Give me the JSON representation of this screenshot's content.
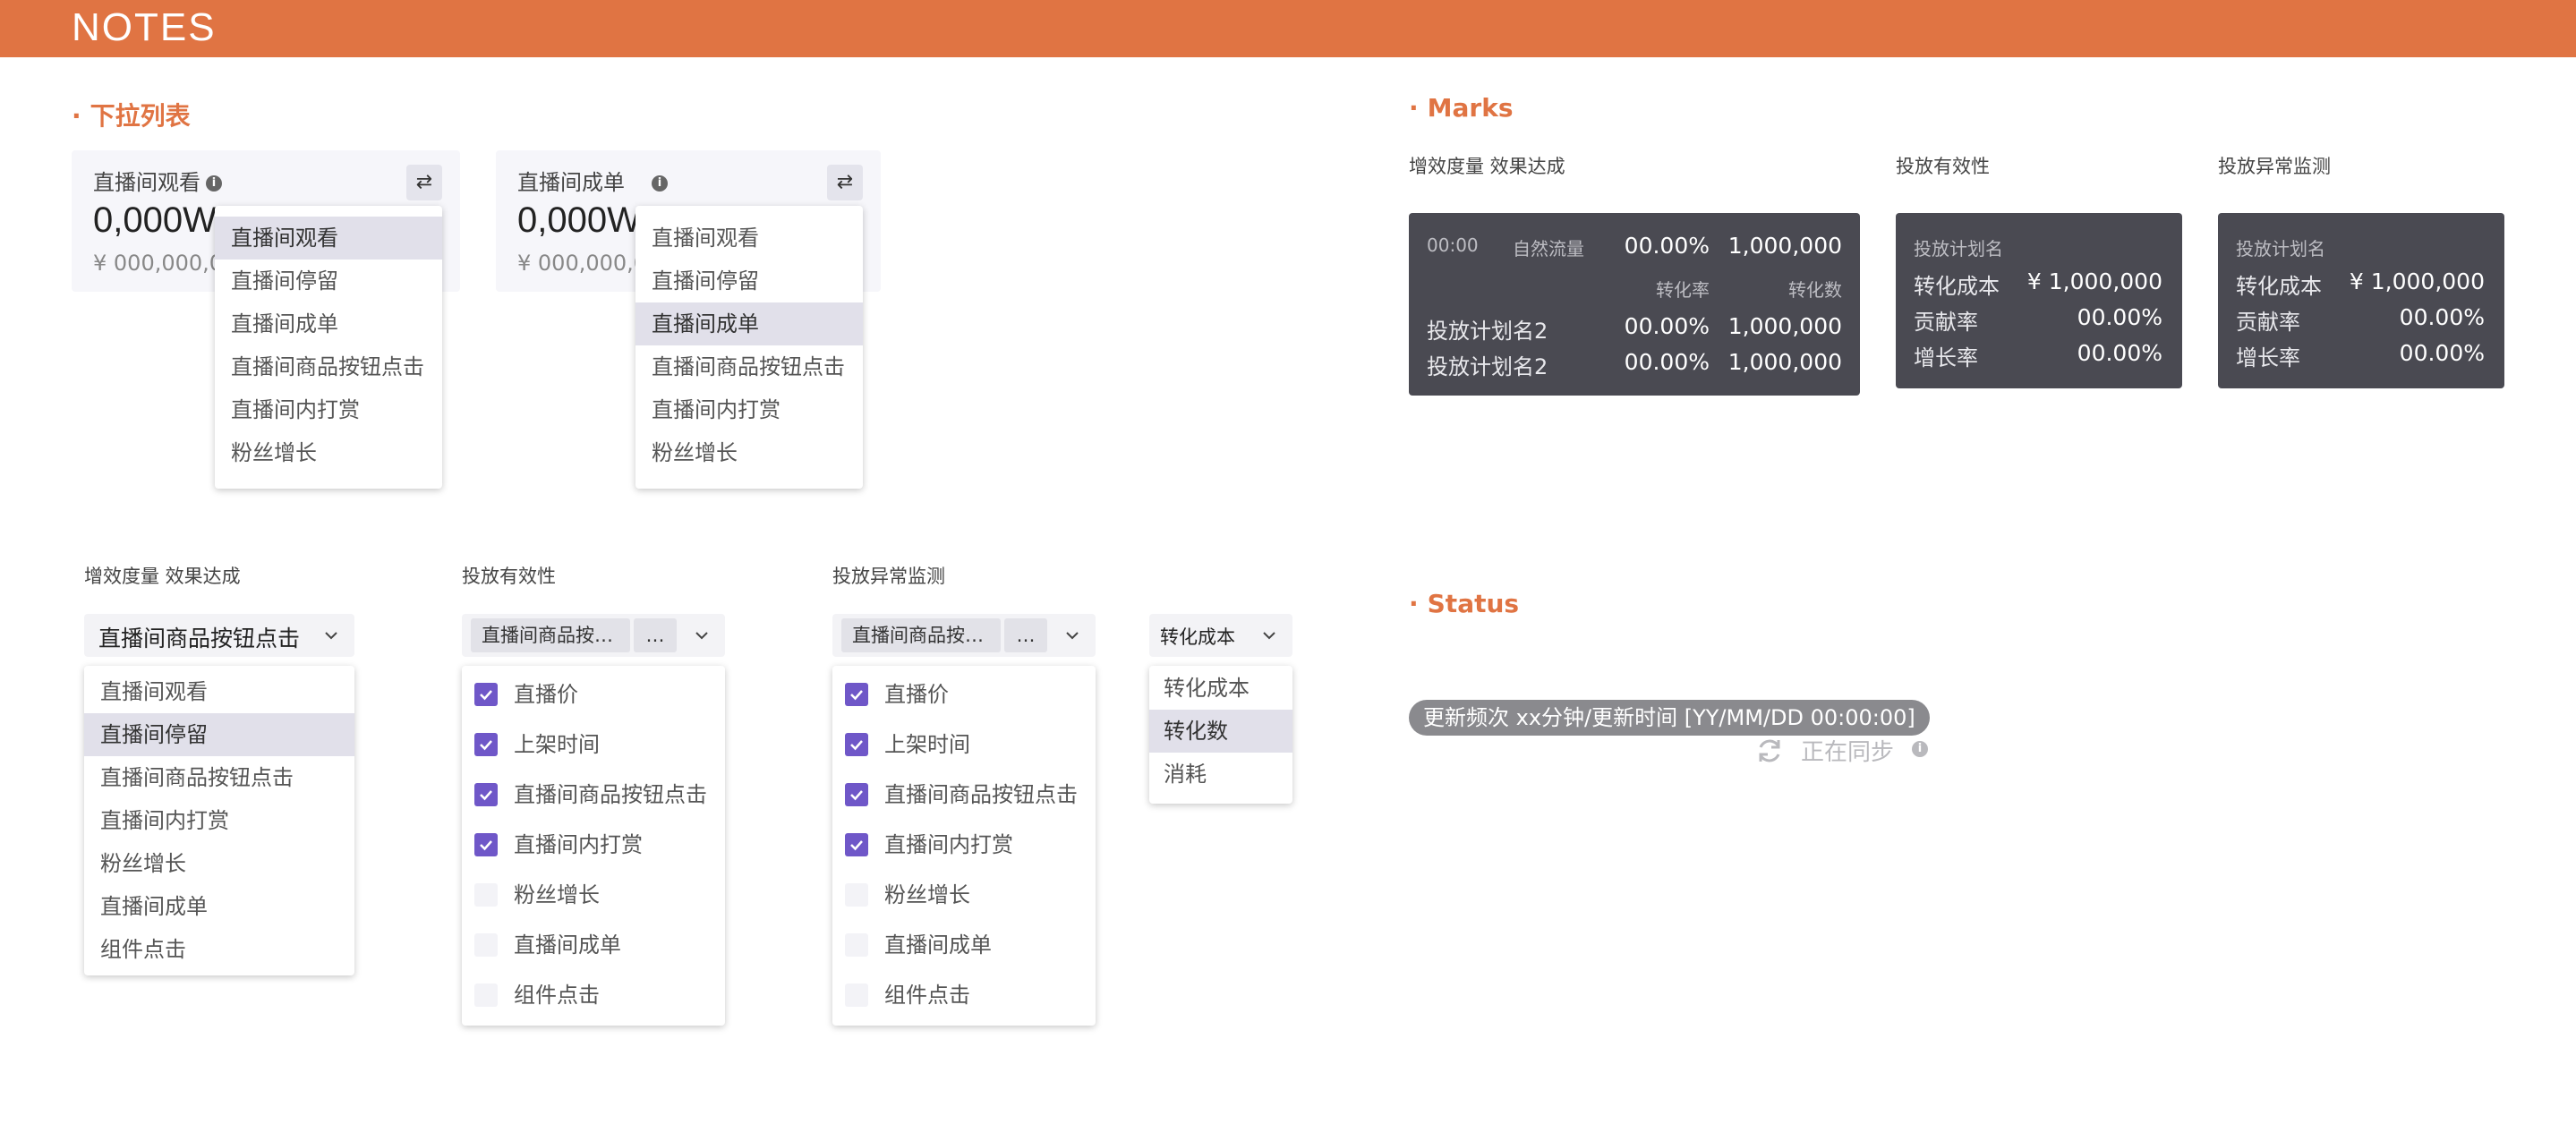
{
  "app": {
    "title": "NOTES"
  },
  "sections": {
    "dropdown": "下拉列表",
    "marks": "Marks",
    "status": "Status"
  },
  "cards": [
    {
      "label": "直播间观看",
      "value": "0,000W",
      "sub": "¥ 000,000,0"
    },
    {
      "label": "直播间成单",
      "value": "0,000W",
      "sub": "¥ 000,000,0"
    }
  ],
  "menu1": {
    "items": [
      "直播间观看",
      "直播间停留",
      "直播间成单",
      "直播间商品按钮点击",
      "直播间内打赏",
      "粉丝增长"
    ],
    "selected": "直播间观看"
  },
  "menu2": {
    "items": [
      "直播间观看",
      "直播间停留",
      "直播间成单",
      "直播间商品按钮点击",
      "直播间内打赏",
      "粉丝增长"
    ],
    "selected": "直播间成单"
  },
  "select1": {
    "label": "增效度量 效果达成",
    "value": "直播间商品按钮点击",
    "items": [
      "直播间观看",
      "直播间停留",
      "直播间商品按钮点击",
      "直播间内打赏",
      "粉丝增长",
      "直播间成单",
      "组件点击"
    ],
    "selected": "直播间停留"
  },
  "select2": {
    "label": "投放有效性",
    "tag": "直播间商品按…",
    "more": "…",
    "options": [
      {
        "label": "直播价",
        "checked": true
      },
      {
        "label": "上架时间",
        "checked": true
      },
      {
        "label": "直播间商品按钮点击",
        "checked": true
      },
      {
        "label": "直播间内打赏",
        "checked": true
      },
      {
        "label": "粉丝增长",
        "checked": false
      },
      {
        "label": "直播间成单",
        "checked": false
      },
      {
        "label": "组件点击",
        "checked": false
      }
    ]
  },
  "select3": {
    "label": "投放异常监测",
    "tag": "直播间商品按…",
    "more": "…",
    "options": [
      {
        "label": "直播价",
        "checked": true
      },
      {
        "label": "上架时间",
        "checked": true
      },
      {
        "label": "直播间商品按钮点击",
        "checked": true
      },
      {
        "label": "直播间内打赏",
        "checked": true
      },
      {
        "label": "粉丝增长",
        "checked": false
      },
      {
        "label": "直播间成单",
        "checked": false
      },
      {
        "label": "组件点击",
        "checked": false
      }
    ]
  },
  "select4": {
    "value": "转化成本",
    "items": [
      "转化成本",
      "转化数",
      "消耗"
    ],
    "selected": "转化数"
  },
  "marks": {
    "m1": {
      "label": "增效度量 效果达成",
      "time": "00:00",
      "series0": "自然流量",
      "v0a": "00.00%",
      "v0b": "1,000,000",
      "h1": "转化率",
      "h2": "转化数",
      "rows": [
        {
          "name": "投放计划名2",
          "a": "00.00%",
          "b": "1,000,000"
        },
        {
          "name": "投放计划名2",
          "a": "00.00%",
          "b": "1,000,000"
        }
      ]
    },
    "m2": {
      "label": "投放有效性",
      "title": "投放计划名",
      "rows": [
        {
          "k": "转化成本",
          "v": "¥ 1,000,000"
        },
        {
          "k": "贡献率",
          "v": "00.00%"
        },
        {
          "k": "增长率",
          "v": "00.00%"
        }
      ]
    },
    "m3": {
      "label": "投放异常监测",
      "title": "投放计划名",
      "rows": [
        {
          "k": "转化成本",
          "v": "¥ 1,000,000"
        },
        {
          "k": "贡献率",
          "v": "00.00%"
        },
        {
          "k": "增长率",
          "v": "00.00%"
        }
      ]
    }
  },
  "status": {
    "update": "更新频次 xx分钟/更新时间 [YY/MM/DD 00:00:00]",
    "sync": "正在同步"
  },
  "colors": {
    "accent": "#E07443",
    "check": "#6F57C8",
    "tooltip": "#4A4A52",
    "selected_row": "#E1E0EA"
  },
  "icons": {
    "info": "info-icon",
    "swap": "swap-icon",
    "chevron": "chevron-down-icon",
    "check": "check-icon",
    "sync": "sync-icon"
  }
}
